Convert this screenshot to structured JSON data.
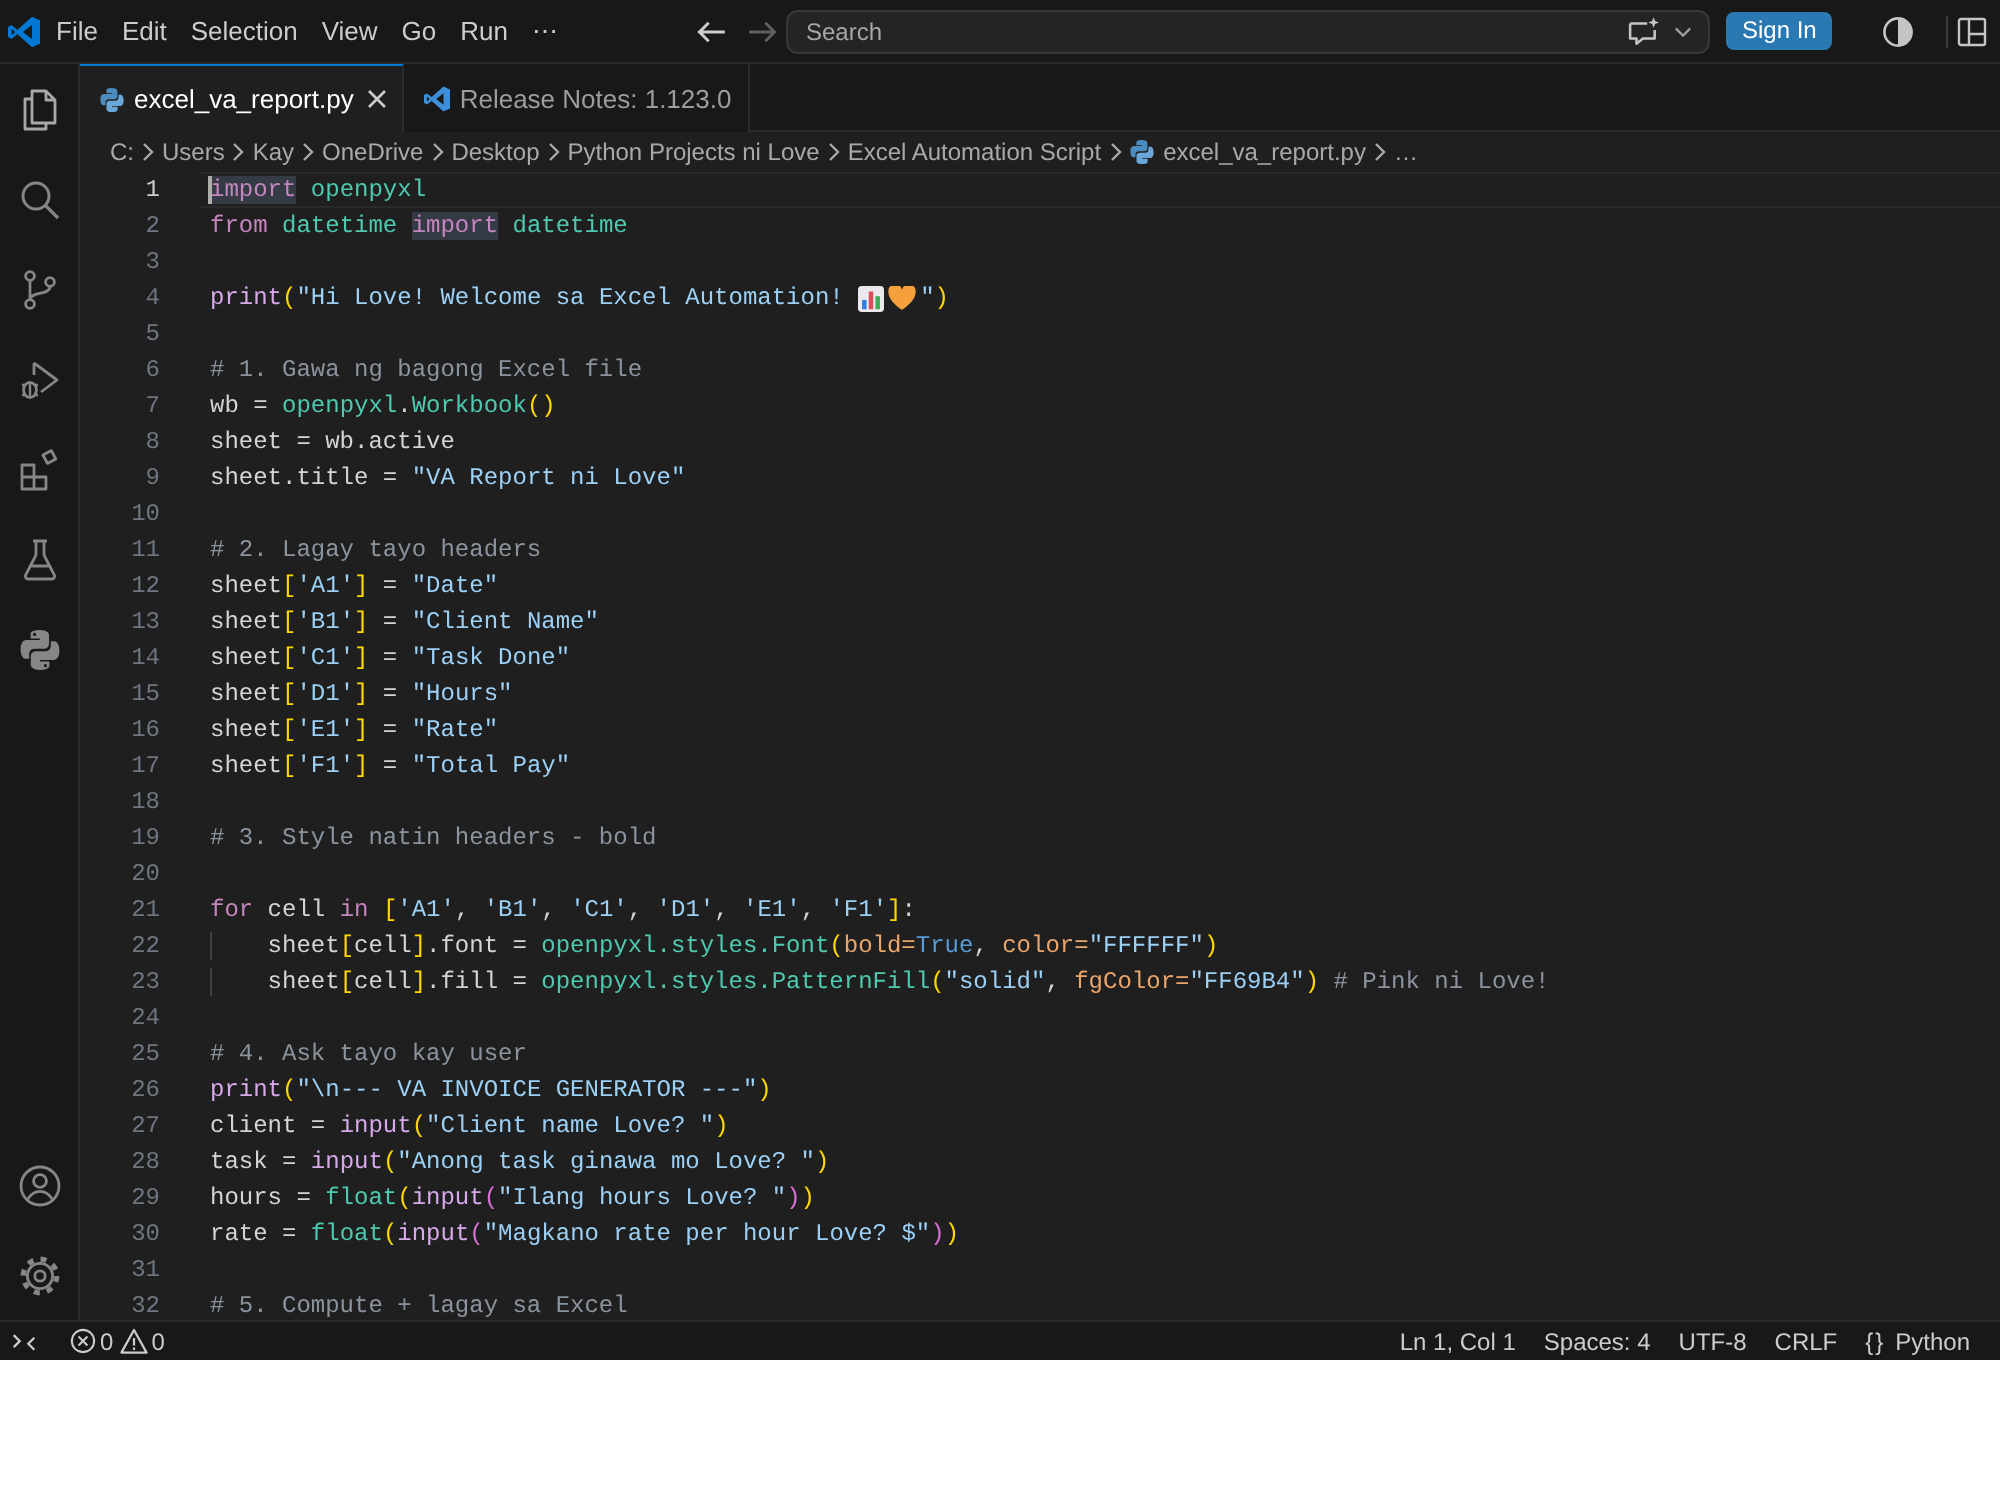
{
  "title_bar": {
    "menu": [
      "File",
      "Edit",
      "Selection",
      "View",
      "Go",
      "Run",
      "⋯"
    ],
    "navigation": [
      {
        "kind": "back",
        "disabled": false
      },
      {
        "kind": "forward",
        "disabled": true
      }
    ],
    "search": {
      "placeholder": "Search"
    },
    "sign_in": "Sign In"
  },
  "tabs": [
    {
      "label": "excel_va_report.py",
      "kind": "python",
      "selected": true
    },
    {
      "label": "Release Notes: 1.123.0",
      "kind": "release",
      "selected": false
    }
  ],
  "breadcrumb": [
    {
      "label": "C:",
      "kind": "folder"
    },
    {
      "label": "Users",
      "kind": "folder"
    },
    {
      "label": "Kay",
      "kind": "folder"
    },
    {
      "label": "OneDrive",
      "kind": "folder"
    },
    {
      "label": "Desktop",
      "kind": "folder"
    },
    {
      "label": "Python Projects ni Love",
      "kind": "folder"
    },
    {
      "label": "Excel Automation Script",
      "kind": "folder"
    },
    {
      "label": "excel_va_report.py",
      "kind": "file"
    },
    {
      "label": "…",
      "kind": "more"
    }
  ],
  "editor": {
    "lines": [
      {
        "number": "1",
        "current": true,
        "tokens": [
          {
            "kind": "match",
            "text": "import"
          },
          {
            "kind": "module",
            "text": " openpyxl"
          }
        ]
      },
      {
        "number": "2",
        "current": false,
        "tokens": [
          {
            "kind": "keyword",
            "text": "from "
          },
          {
            "kind": "module",
            "text": "datetime "
          },
          {
            "kind": "match",
            "text": "import"
          },
          {
            "kind": "module",
            "text": " datetime"
          }
        ]
      },
      {
        "number": "3",
        "current": false
      },
      {
        "number": "4",
        "current": false,
        "tokens": [
          {
            "kind": "function",
            "text": "print"
          },
          {
            "kind": "bracket1",
            "text": "("
          },
          {
            "kind": "string",
            "text": "\"Hi Love! Welcome sa Excel Automation! "
          },
          {
            "kind": "chart"
          },
          {
            "kind": "heart"
          },
          {
            "kind": "string",
            "text": "\""
          },
          {
            "kind": "bracket1",
            "text": ")"
          }
        ]
      },
      {
        "number": "5",
        "current": false
      },
      {
        "number": "6",
        "current": false,
        "tokens": [
          {
            "kind": "comment",
            "text": "# 1. Gawa ng bagong Excel file"
          }
        ]
      },
      {
        "number": "7",
        "current": false,
        "tokens": [
          {
            "kind": "plain",
            "text": "wb = "
          },
          {
            "kind": "module",
            "text": "openpyxl"
          },
          {
            "kind": "plain",
            "text": "."
          },
          {
            "kind": "module",
            "text": "Workbook"
          },
          {
            "kind": "bracket1",
            "text": "()"
          }
        ]
      },
      {
        "number": "8",
        "current": false,
        "tokens": [
          {
            "kind": "plain",
            "text": "sheet = wb.active"
          }
        ]
      },
      {
        "number": "9",
        "current": false,
        "tokens": [
          {
            "kind": "plain",
            "text": "sheet.title = "
          },
          {
            "kind": "string",
            "text": "\"VA Report ni Love\""
          }
        ]
      },
      {
        "number": "10",
        "current": false
      },
      {
        "number": "11",
        "current": false,
        "tokens": [
          {
            "kind": "comment",
            "text": "# 2. Lagay tayo headers"
          }
        ]
      },
      {
        "number": "12",
        "current": false,
        "tokens": [
          {
            "kind": "plain",
            "text": "sheet"
          },
          {
            "kind": "bracket1",
            "text": "["
          },
          {
            "kind": "string",
            "text": "'A1'"
          },
          {
            "kind": "bracket1",
            "text": "]"
          },
          {
            "kind": "plain",
            "text": " = "
          },
          {
            "kind": "string",
            "text": "\"Date\""
          }
        ]
      },
      {
        "number": "13",
        "current": false,
        "tokens": [
          {
            "kind": "plain",
            "text": "sheet"
          },
          {
            "kind": "bracket1",
            "text": "["
          },
          {
            "kind": "string",
            "text": "'B1'"
          },
          {
            "kind": "bracket1",
            "text": "]"
          },
          {
            "kind": "plain",
            "text": " = "
          },
          {
            "kind": "string",
            "text": "\"Client Name\""
          }
        ]
      },
      {
        "number": "14",
        "current": false,
        "tokens": [
          {
            "kind": "plain",
            "text": "sheet"
          },
          {
            "kind": "bracket1",
            "text": "["
          },
          {
            "kind": "string",
            "text": "'C1'"
          },
          {
            "kind": "bracket1",
            "text": "]"
          },
          {
            "kind": "plain",
            "text": " = "
          },
          {
            "kind": "string",
            "text": "\"Task Done\""
          }
        ]
      },
      {
        "number": "15",
        "current": false,
        "tokens": [
          {
            "kind": "plain",
            "text": "sheet"
          },
          {
            "kind": "bracket1",
            "text": "["
          },
          {
            "kind": "string",
            "text": "'D1'"
          },
          {
            "kind": "bracket1",
            "text": "]"
          },
          {
            "kind": "plain",
            "text": " = "
          },
          {
            "kind": "string",
            "text": "\"Hours\""
          }
        ]
      },
      {
        "number": "16",
        "current": false,
        "tokens": [
          {
            "kind": "plain",
            "text": "sheet"
          },
          {
            "kind": "bracket1",
            "text": "["
          },
          {
            "kind": "string",
            "text": "'E1'"
          },
          {
            "kind": "bracket1",
            "text": "]"
          },
          {
            "kind": "plain",
            "text": " = "
          },
          {
            "kind": "string",
            "text": "\"Rate\""
          }
        ]
      },
      {
        "number": "17",
        "current": false,
        "tokens": [
          {
            "kind": "plain",
            "text": "sheet"
          },
          {
            "kind": "bracket1",
            "text": "["
          },
          {
            "kind": "string",
            "text": "'F1'"
          },
          {
            "kind": "bracket1",
            "text": "]"
          },
          {
            "kind": "plain",
            "text": " = "
          },
          {
            "kind": "string",
            "text": "\"Total Pay\""
          }
        ]
      },
      {
        "number": "18",
        "current": false
      },
      {
        "number": "19",
        "current": false,
        "tokens": [
          {
            "kind": "comment",
            "text": "# 3. Style natin headers - bold"
          }
        ]
      },
      {
        "number": "20",
        "current": false
      },
      {
        "number": "21",
        "current": false,
        "tokens": [
          {
            "kind": "keyword",
            "text": "for"
          },
          {
            "kind": "plain",
            "text": " cell "
          },
          {
            "kind": "keyword",
            "text": "in "
          },
          {
            "kind": "bracket1",
            "text": "["
          },
          {
            "kind": "string",
            "text": "'A1'"
          },
          {
            "kind": "plain",
            "text": ", "
          },
          {
            "kind": "string",
            "text": "'B1'"
          },
          {
            "kind": "plain",
            "text": ", "
          },
          {
            "kind": "string",
            "text": "'C1'"
          },
          {
            "kind": "plain",
            "text": ", "
          },
          {
            "kind": "string",
            "text": "'D1'"
          },
          {
            "kind": "plain",
            "text": ", "
          },
          {
            "kind": "string",
            "text": "'E1'"
          },
          {
            "kind": "plain",
            "text": ", "
          },
          {
            "kind": "string",
            "text": "'F1'"
          },
          {
            "kind": "bracket1",
            "text": "]"
          },
          {
            "kind": "plain",
            "text": ":"
          }
        ]
      },
      {
        "number": "22",
        "current": false,
        "tokens": [
          {
            "kind": "indented",
            "text": "    sheet"
          },
          {
            "kind": "bracket1",
            "text": "["
          },
          {
            "kind": "plain",
            "text": "cell"
          },
          {
            "kind": "bracket1",
            "text": "]"
          },
          {
            "kind": "plain",
            "text": ".font = "
          },
          {
            "kind": "module",
            "text": "openpyxl.styles.Font"
          },
          {
            "kind": "bracket1",
            "text": "("
          },
          {
            "kind": "param",
            "text": "bold="
          },
          {
            "kind": "constant",
            "text": "True"
          },
          {
            "kind": "plain",
            "text": ", "
          },
          {
            "kind": "param",
            "text": "color="
          },
          {
            "kind": "string",
            "text": "\"FFFFFF\""
          },
          {
            "kind": "bracket1",
            "text": ")"
          }
        ]
      },
      {
        "number": "23",
        "current": false,
        "tokens": [
          {
            "kind": "indented",
            "text": "    sheet"
          },
          {
            "kind": "bracket1",
            "text": "["
          },
          {
            "kind": "plain",
            "text": "cell"
          },
          {
            "kind": "bracket1",
            "text": "]"
          },
          {
            "kind": "plain",
            "text": ".fill = "
          },
          {
            "kind": "module",
            "text": "openpyxl.styles.PatternFill"
          },
          {
            "kind": "bracket1",
            "text": "("
          },
          {
            "kind": "string",
            "text": "\"solid\""
          },
          {
            "kind": "plain",
            "text": ", "
          },
          {
            "kind": "param",
            "text": "fgColor="
          },
          {
            "kind": "string",
            "text": "\"FF69B4\""
          },
          {
            "kind": "bracket1",
            "text": ")"
          },
          {
            "kind": "comment",
            "text": " # Pink ni Love!"
          }
        ]
      },
      {
        "number": "24",
        "current": false
      },
      {
        "number": "25",
        "current": false,
        "tokens": [
          {
            "kind": "comment",
            "text": "# 4. Ask tayo kay user"
          }
        ]
      },
      {
        "number": "26",
        "current": false,
        "tokens": [
          {
            "kind": "function",
            "text": "print"
          },
          {
            "kind": "bracket1",
            "text": "("
          },
          {
            "kind": "string",
            "text": "\"\\n--- VA INVOICE GENERATOR ---\""
          },
          {
            "kind": "bracket1",
            "text": ")"
          }
        ]
      },
      {
        "number": "27",
        "current": false,
        "tokens": [
          {
            "kind": "plain",
            "text": "client = "
          },
          {
            "kind": "function",
            "text": "input"
          },
          {
            "kind": "bracket1",
            "text": "("
          },
          {
            "kind": "string",
            "text": "\"Client name Love? \""
          },
          {
            "kind": "bracket1",
            "text": ")"
          }
        ]
      },
      {
        "number": "28",
        "current": false,
        "tokens": [
          {
            "kind": "plain",
            "text": "task = "
          },
          {
            "kind": "function",
            "text": "input"
          },
          {
            "kind": "bracket1",
            "text": "("
          },
          {
            "kind": "string",
            "text": "\"Anong task ginawa mo Love? \""
          },
          {
            "kind": "bracket1",
            "text": ")"
          }
        ]
      },
      {
        "number": "29",
        "current": false,
        "tokens": [
          {
            "kind": "plain",
            "text": "hours = "
          },
          {
            "kind": "module",
            "text": "float"
          },
          {
            "kind": "bracket1",
            "text": "("
          },
          {
            "kind": "function",
            "text": "input"
          },
          {
            "kind": "bracket2",
            "text": "("
          },
          {
            "kind": "string",
            "text": "\"Ilang hours Love? \""
          },
          {
            "kind": "bracket2",
            "text": ")"
          },
          {
            "kind": "bracket1",
            "text": ")"
          }
        ]
      },
      {
        "number": "30",
        "current": false,
        "tokens": [
          {
            "kind": "plain",
            "text": "rate = "
          },
          {
            "kind": "module",
            "text": "float"
          },
          {
            "kind": "bracket1",
            "text": "("
          },
          {
            "kind": "function",
            "text": "input"
          },
          {
            "kind": "bracket2",
            "text": "("
          },
          {
            "kind": "string",
            "text": "\"Magkano rate per hour Love? $\""
          },
          {
            "kind": "bracket2",
            "text": ")"
          },
          {
            "kind": "bracket1",
            "text": ")"
          }
        ]
      },
      {
        "number": "31",
        "current": false
      },
      {
        "number": "32",
        "current": false,
        "tokens": [
          {
            "kind": "comment",
            "text": "# 5. Compute + lagay sa Excel"
          }
        ]
      }
    ]
  },
  "status_bar": {
    "errors": "0",
    "warnings": "0",
    "items": [
      "Ln 1, Col 1",
      "Spaces: 4",
      "UTF-8",
      "CRLF"
    ],
    "language": {
      "glyph": "{}",
      "label": "Python"
    }
  }
}
